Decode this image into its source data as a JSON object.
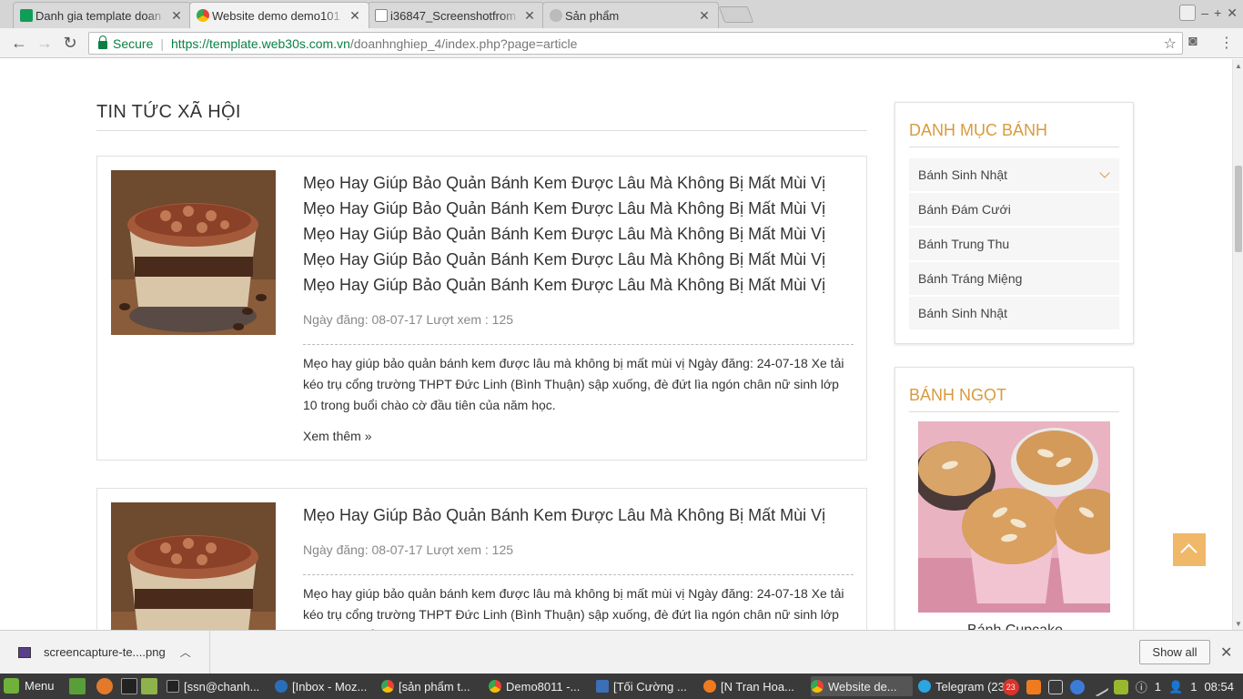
{
  "browser": {
    "tabs": [
      {
        "title": "Danh gia template doan",
        "favicon_color": "#0f9d58"
      },
      {
        "title": "Website demo demo101",
        "favicon_color": "#4285f4"
      },
      {
        "title": "i36847_Screenshotfrom",
        "favicon_color": "#9e9e9e"
      },
      {
        "title": "Sản phẩm",
        "favicon_color": "#9e9e9e"
      }
    ],
    "tab_close": "✕",
    "security_label": "Secure",
    "url_host": "https://template.web30s.com.vn",
    "url_path": "/doanhnghiep_4/index.php?page=article"
  },
  "page": {
    "section_title": "TIN TỨC XÃ HỘI",
    "articles": [
      {
        "title": "Mẹo Hay Giúp Bảo Quản Bánh Kem Được Lâu Mà Không Bị Mất Mùi Vị Mẹo Hay Giúp Bảo Quản Bánh Kem Được Lâu Mà Không Bị Mất Mùi Vị Mẹo Hay Giúp Bảo Quản Bánh Kem Được Lâu Mà Không Bị Mất Mùi Vị Mẹo Hay Giúp Bảo Quản Bánh Kem Được Lâu Mà Không Bị Mất Mùi Vị Mẹo Hay Giúp Bảo Quản Bánh Kem Được Lâu Mà Không Bị Mất Mùi Vị",
        "meta": "Ngày đăng: 08-07-17 Lượt xem : 125",
        "desc": "Mẹo hay giúp bảo quản bánh kem được lâu mà không bị mất mùi vị Ngày đăng: 24-07-18 Xe tải kéo trụ cổng trường THPT Đức Linh (Bình Thuận) sập xuống, đè đứt lìa ngón chân nữ sinh lớp 10 trong buổi chào cờ đầu tiên của năm học.",
        "more": "Xem thêm »"
      },
      {
        "title": "Mẹo Hay Giúp Bảo Quản Bánh Kem Được Lâu Mà Không Bị Mất Mùi Vị",
        "meta": "Ngày đăng: 08-07-17 Lượt xem : 125",
        "desc": "Mẹo hay giúp bảo quản bánh kem được lâu mà không bị mất mùi vị Ngày đăng: 24-07-18 Xe tải kéo trụ cổng trường THPT Đức Linh (Bình Thuận) sập xuống, đè đứt lìa ngón chân nữ sinh lớp 10 trong buổi chào cờ đầu tiên của năm học."
      }
    ]
  },
  "sidebar": {
    "categories_title": "DANH MỤC BÁNH",
    "categories": [
      "Bánh Sinh Nhật",
      "Bánh Đám Cưới",
      "Bánh Trung Thu",
      "Bánh Tráng Miệng",
      "Bánh Sinh Nhật"
    ],
    "sweets_title": "BÁNH NGỌT",
    "product_name": "Bánh Cupcake"
  },
  "download": {
    "file": "screencapture-te....png",
    "show_all": "Show all"
  },
  "taskbar": {
    "menu": "Menu",
    "windows": [
      {
        "label": "[ssn@chanh...",
        "color": "#222"
      },
      {
        "label": "[Inbox - Moz...",
        "color": "#2a6ebb"
      },
      {
        "label": "[sản phẩm t...",
        "color": "#e8a33a"
      },
      {
        "label": "Demo8011 -...",
        "color": "#e8a33a"
      },
      {
        "label": "[Tối Cường ...",
        "color": "#3b6fb6"
      },
      {
        "label": "[N Tran Hoa...",
        "color": "#f07b1e"
      },
      {
        "label": "Website de...",
        "color": "#e8a33a"
      },
      {
        "label": "Telegram (23)",
        "color": "#2ca5e0"
      }
    ],
    "badge": "23",
    "notif_count": "1",
    "users": "1",
    "clock": "08:54"
  },
  "colors": {
    "accent": "#d99a3e",
    "secure_green": "#0b8043",
    "to_top": "#f0b869"
  }
}
